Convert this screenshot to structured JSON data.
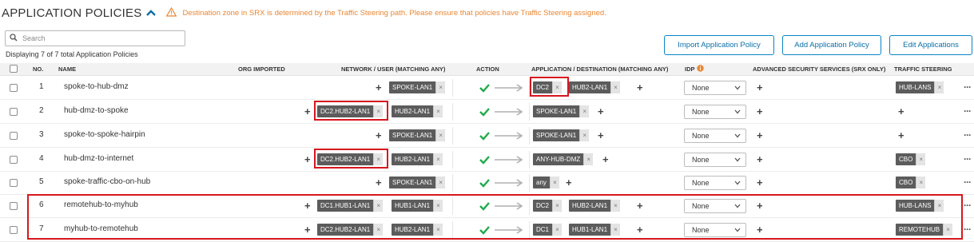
{
  "header": {
    "title": "APPLICATION POLICIES",
    "warning": "Destination zone in SRX is determined by the Traffic Steering path. Please ensure that policies have Traffic Steering assigned.",
    "colors": {
      "warning": "#e98734",
      "accent": "#0b84c5",
      "highlight": "#d6171e"
    }
  },
  "search": {
    "placeholder": "Search",
    "value": ""
  },
  "count_text": "Displaying 7 of 7 total Application Policies",
  "buttons": {
    "import": "Import Application Policy",
    "add": "Add Application Policy",
    "edit": "Edit Applications"
  },
  "columns": {
    "no": "NO.",
    "name": "NAME",
    "org": "ORG IMPORTED",
    "network": "NETWORK / USER (MATCHING ANY)",
    "action": "ACTION",
    "application": "APPLICATION / DESTINATION (MATCHING ANY)",
    "idp": "IDP",
    "srx": "ADVANCED SECURITY SERVICES (SRX ONLY)",
    "steering": "TRAFFIC STEERING"
  },
  "rows": [
    {
      "no": "1",
      "name": "spoke-to-hub-dmz",
      "net1": "SPOKE-LAN1",
      "app1": "DC2",
      "app2": "HUB2-LAN1",
      "idp": "None",
      "steering": "HUB-LANS"
    },
    {
      "no": "2",
      "name": "hub-dmz-to-spoke",
      "net1": "DC2.HUB2-LAN1",
      "net2": "HUB2-LAN1",
      "app1": "SPOKE-LAN1",
      "idp": "None"
    },
    {
      "no": "3",
      "name": "spoke-to-spoke-hairpin",
      "net1": "SPOKE-LAN1",
      "app1": "SPOKE-LAN1",
      "idp": "None"
    },
    {
      "no": "4",
      "name": "hub-dmz-to-internet",
      "net1": "DC2.HUB2-LAN1",
      "net2": "HUB2-LAN1",
      "app1": "ANY-HUB-DMZ",
      "idp": "None",
      "steering": "CBO"
    },
    {
      "no": "5",
      "name": "spoke-traffic-cbo-on-hub",
      "net1": "SPOKE-LAN1",
      "app1": "any",
      "idp": "None",
      "steering": "CBO"
    },
    {
      "no": "6",
      "name": "remotehub-to-myhub",
      "net1": "DC1.HUB1-LAN1",
      "net2": "HUB1-LAN1",
      "app1": "DC2",
      "app2": "HUB2-LAN1",
      "idp": "None",
      "steering": "HUB-LANS"
    },
    {
      "no": "7",
      "name": "myhub-to-remotehub",
      "net1": "DC2.HUB2-LAN1",
      "net2": "HUB2-LAN1",
      "app1": "DC1",
      "app2": "HUB1-LAN1",
      "idp": "None",
      "steering": "REMOTEHUB"
    }
  ],
  "icons": {
    "chevron": "chevron-up-icon",
    "warning": "warning-triangle-icon",
    "search": "search-icon",
    "idp_info": "info-icon"
  }
}
